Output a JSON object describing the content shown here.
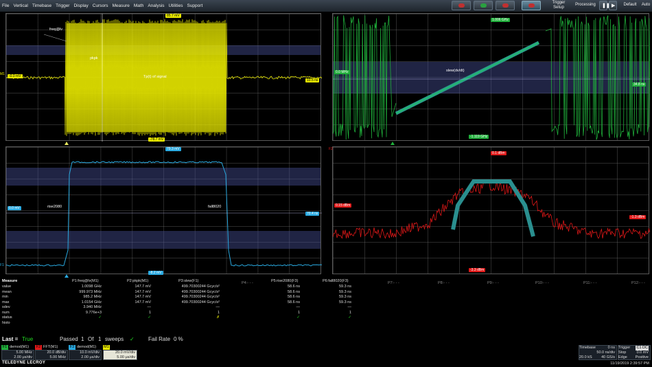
{
  "menu": [
    "File",
    "Vertical",
    "Timebase",
    "Trigger",
    "Display",
    "Cursors",
    "Measure",
    "Math",
    "Analysis",
    "Utilities",
    "Support"
  ],
  "toolbar": {
    "trigger_setup": "Trigger Setup",
    "processing": "Processing",
    "default": "Default",
    "auto": "Auto"
  },
  "grids": {
    "g1": {
      "tag_top": "85.7 mV",
      "tag_bottom": "-78.7 mV",
      "tag_left": "-0.0 mV",
      "tag_right": "10.5 ns",
      "m1": "M1",
      "param_label": "freq@lv",
      "annot1": "pkpk",
      "annot2": "Tp(t) of signal"
    },
    "g2": {
      "tag_top": "1.006 GHz",
      "tag_bottom": "-1.119 GHz",
      "tag_left": "0.0 MHz",
      "tag_right": "34.8 ns",
      "param_label": "slew(dv/dt)"
    },
    "g3": {
      "tag_top": "79.3 mV",
      "tag_bottom": "-8.2 mV",
      "tag_left": "0.0 mV",
      "tag_right": "70.4 ns",
      "rise": "rise2080",
      "fall": "fall8020",
      "f1": "F1"
    },
    "g4": {
      "tag_top": "0.1 dBm",
      "tag_bottom": "-3.3 dBm",
      "tag_left": "0.15 dBm",
      "tag_right": "-1.3 dBm",
      "f2": "F2"
    }
  },
  "param_slots": [
    "P4:- - -",
    "P7:- - -",
    "P8:- - -",
    "P9:- - -",
    "P10:- - -",
    "P11:- - -",
    "P12:- - -"
  ],
  "measure": {
    "header": [
      "Measure",
      "P1:freq@lv(M1)",
      "P2:pkpk(M1)",
      "P3:slew(F1)",
      "P5:rise2080(F3)",
      "P6:fall8020(F3)"
    ],
    "rows": [
      [
        "value",
        "1.0098 GHz",
        "147.7 mV",
        "499.70300244 Gcyc/s²",
        "58.6 ns",
        "59.3 ns"
      ],
      [
        "mean",
        "999.973 MHz",
        "147.7 mV",
        "499.70300244 Gcyc/s²",
        "58.6 ns",
        "59.3 ns"
      ],
      [
        "min",
        "985.2 MHz",
        "147.7 mV",
        "499.70300244 Gcyc/s²",
        "58.6 ns",
        "59.3 ns"
      ],
      [
        "max",
        "1.0154 GHz",
        "147.7 mV",
        "499.70300244 Gcyc/s²",
        "58.6 ns",
        "59.3 ns"
      ],
      [
        "sdev",
        "3.940 MHz",
        "—",
        "—",
        "—",
        "—"
      ],
      [
        "num",
        "9.776e+3",
        "1",
        "1",
        "1",
        "1"
      ],
      [
        "status",
        "✓",
        "✓",
        "✗",
        "✓",
        "✓"
      ],
      [
        "histo",
        "",
        "",
        "",
        "",
        ""
      ]
    ]
  },
  "status": {
    "last_label": "Last =",
    "last_value": "True",
    "passed_label": "Passed",
    "passed": "1",
    "of": "Of",
    "total": "1",
    "sweeps": "sweeps",
    "fail_label": "Fail Rate",
    "fail_value": "0 %"
  },
  "channel_tiles": [
    {
      "id": "F1",
      "name": "demod(M1)",
      "l1": "5.00 MHz",
      "l2": "2.00 μs/div",
      "color": "#1fae3a"
    },
    {
      "id": "F2",
      "name": "FFT(M1)",
      "l1": "20.0 dB/div",
      "l2": "5.00 MHz",
      "color": "#e01818"
    },
    {
      "id": "F3",
      "name": "demod(M1)",
      "l1": "10.0 mV/div",
      "l2": "2.00 μs/div",
      "color": "#29a9e0"
    },
    {
      "id": "M1",
      "name": "",
      "l1": "20.0 mV/div",
      "l2": "5.00 μs/div",
      "color": "#e8e800"
    }
  ],
  "timebase": {
    "label": "Timebase",
    "delay": "0 ns",
    "div": "50.0 ns/div",
    "samples": "20.0 kS",
    "rate": "40 GS/s"
  },
  "trigger": {
    "label": "Trigger",
    "chan": "C1 DC",
    "stop": "Stop",
    "level": "0.0 mV",
    "edge": "Edge",
    "slope": "Positive"
  },
  "brand": "TELEDYNE LECROY",
  "datetime": "11/19/2019 2:39:57 PM"
}
